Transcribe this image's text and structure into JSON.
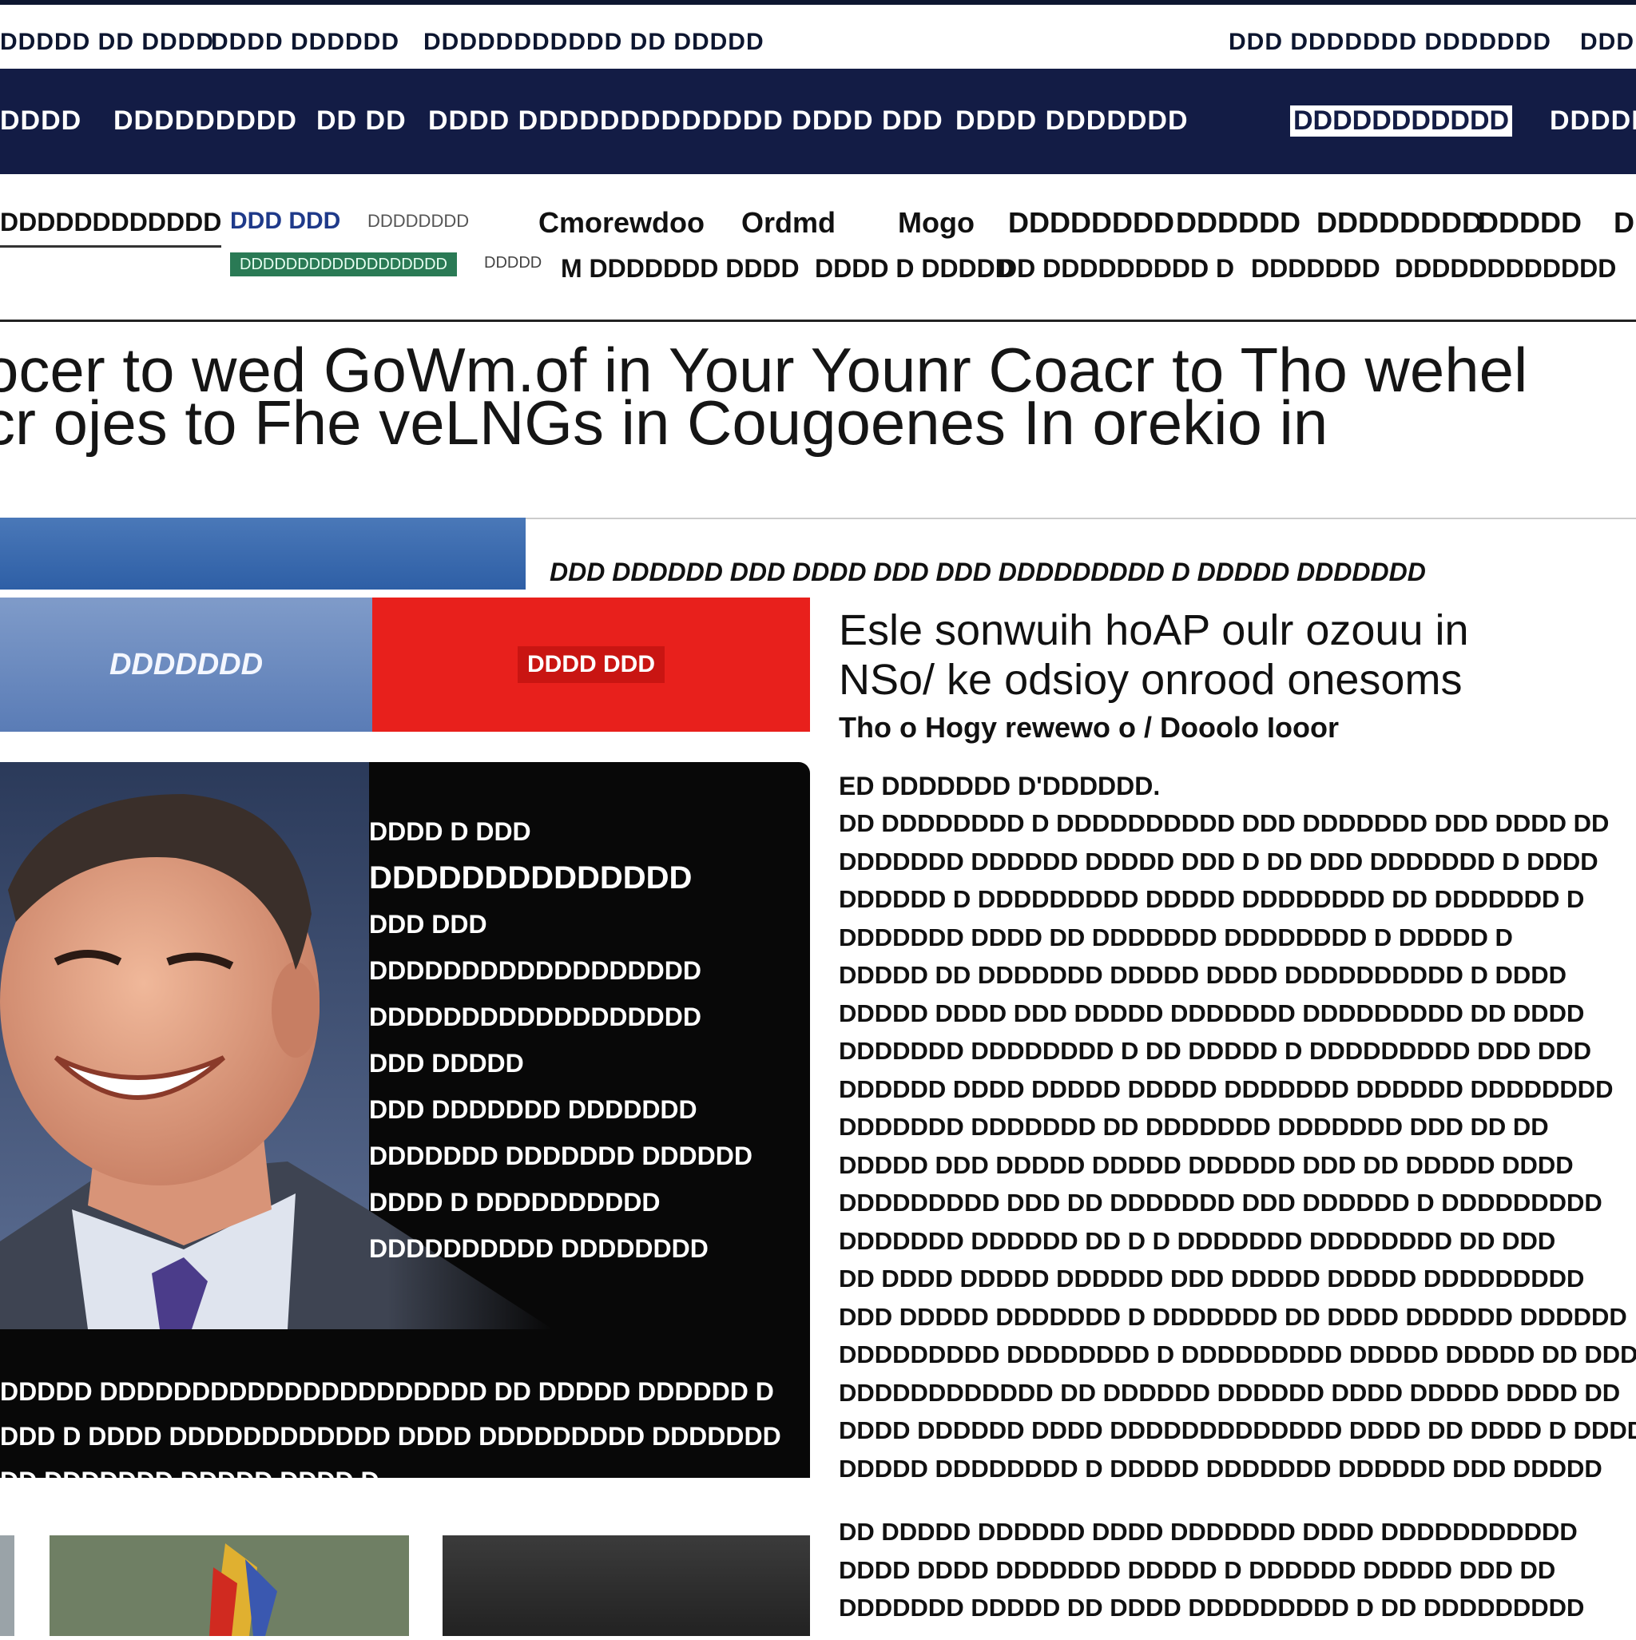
{
  "utility_bar": {
    "links": [
      "DDDDD DD DDDD",
      "DDDD DDDDDD",
      "DDDDDDDDDDD DD DDDDD"
    ],
    "right_links": [
      "DDD DDDDDDD DDDDDDD",
      "DDD"
    ]
  },
  "main_nav": {
    "items": [
      "DDDD",
      "DDDDDDDDD",
      "DD DD",
      "DDDD DDDDDDDDDDDDD DDDD DDD",
      "DDDD DDDDDDD"
    ],
    "highlighted": "DDDDDDDDDDD",
    "last": "DDDDD"
  },
  "sub_nav": {
    "section_label": "DDDDDDDDDDDD",
    "edition": "DDD DDD",
    "edition_date": "DDDDDDDD",
    "ticker": "DDDDDDDDDDDDDDDDDD",
    "ticker_small": "DDDDD",
    "row1": [
      "Cmorewdoo",
      "Ordmd",
      "Mogo",
      "DDDDDDDD",
      "DDDDDD",
      "DDDDDDDD",
      "DDDDD",
      "D"
    ],
    "row2": [
      "M DDDDDDD DDDD",
      "DDDD D DDDDD",
      "DD DDDDDDDDD D",
      "DDDDDDD",
      "DDDDDDDDDDDD"
    ]
  },
  "headline": {
    "line1": "ocer to wed GoWm.of in Your Younr Coacr to Tho wehel",
    "line2": "cr ojes to Fhe veLNGs in Cougoenes In orekio in"
  },
  "kicker": "DDD DDDDDD DDD DDDD DDD DDD DDDDDDDDD D DDDDD DDDDDDD",
  "buttons": {
    "blue_label": "DDDDDDD",
    "red_label": "DDDD DDD"
  },
  "feature_card": {
    "lines": [
      "DDDD D DDD",
      "DDDDDDDDDDDDDD",
      "DDD DDD",
      "DDDDDDDDDDDDDDDDDD",
      "DDDDDDDDDDDDDDDDDD",
      "DDD DDDDD",
      "DDD DDDDDDD DDDDDDD",
      "DDDDDDD DDDDDDD DDDDDD",
      "DDDD D DDDDDDDDDD",
      "DDDDDDDDDD DDDDDDDD"
    ],
    "caption": [
      "DDDDD DDDDDDDDDDDDDDDDDDDDD DD DDDDD DDDDDD D",
      "DDD D DDDD DDDDDDDDDDDD DDDD DDDDDDDDD DDDDDDD",
      "DD DDDDDDD DDDDD DDDD D"
    ]
  },
  "article": {
    "title_line1": "Esle sonwuih hoAP oulr ozouu in",
    "title_line2": "NSo/ ke odsioy onrood onesoms",
    "deck": "Tho o Hogy rewewo o / Dooolo Iooor",
    "byline": "ED DDDDDDD D'DDDDDD.",
    "para1": [
      "DD DDDDDDDD D DDDDDDDDDD DDD DDDDDDD DDD DDDD DD",
      "DDDDDDD DDDDDD DDDDD DDD D DD DDD DDDDDDD D DDDD",
      "DDDDDD D DDDDDDDDD DDDDD DDDDDDDD DD DDDDDDD D",
      "DDDDDDD DDDD DD DDDDDDD DDDDDDDD D DDDDD D",
      "DDDDD DD DDDDDDD DDDDD DDDD DDDDDDDDDD D DDDD",
      "DDDDD DDDD DDD DDDDD DDDDDDD DDDDDDDDD DD DDDD",
      "DDDDDDD DDDDDDDD D DD DDDDD D DDDDDDDDD DDD DDD",
      "DDDDDD DDDD DDDDD DDDDD DDDDDDD DDDDDD DDDDDDDD",
      "DDDDDDD DDDDDDD DD DDDDDDD DDDDDDD DDD DD DD",
      "DDDDD DDD DDDDD DDDDD DDDDDD DDD DD DDDDD DDDD",
      "DDDDDDDDD DDD DD DDDDDDD DDD DDDDDD D DDDDDDDDD",
      "DDDDDDD DDDDDD DD D D DDDDDDD DDDDDDDD DD DDD",
      "DD DDDD DDDDD DDDDDD DDD DDDDD DDDDD DDDDDDDDD",
      "DDD DDDDD DDDDDDD D DDDDDDD DD DDDD DDDDDD DDDDDD",
      "DDDDDDDDD DDDDDDDD D DDDDDDDDD DDDDD DDDDD DD DDD",
      "DDDDDDDDDDDD DD DDDDDD DDDDDD DDDD DDDDD DDDD DD",
      "DDDD DDDDDD DDDD DDDDDDDDDDDDD DDDD DD DDDD D DDDD",
      "DDDDD DDDDDDDD D DDDDD DDDDDDD DDDDDD DDD DDDDD"
    ],
    "para2": [
      "DD DDDDD DDDDDD DDDD DDDDDDD DDDD DDDDDDDDDDD",
      "DDDD DDDD DDDDDDD DDDDD D DDDDDD DDDDD DDD DD",
      "DDDDDDD DDDDD DD DDDD DDDDDDDDD D DD DDDDDDDDD"
    ]
  },
  "colors": {
    "nav_bg": "#131c45",
    "accent_red": "#e8201c",
    "accent_blue": "#5a7cb6",
    "ticker_green": "#2a7a55"
  }
}
